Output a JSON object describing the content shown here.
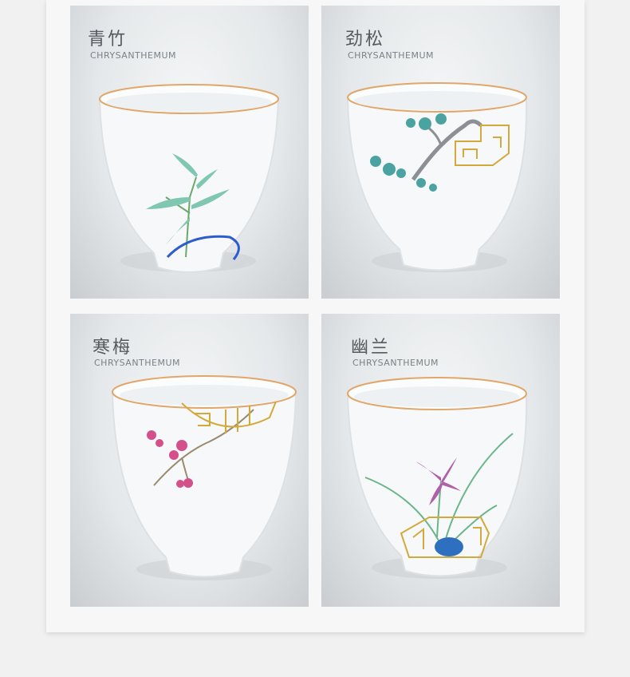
{
  "products": [
    {
      "name": "青竹",
      "subtitle": "CHRYSANTHEMUM",
      "motif": "bamboo"
    },
    {
      "name": "劲松",
      "subtitle": "CHRYSANTHEMUM",
      "motif": "pine"
    },
    {
      "name": "寒梅",
      "subtitle": "CHRYSANTHEMUM",
      "motif": "plum-blossom"
    },
    {
      "name": "幽兰",
      "subtitle": "CHRYSANTHEMUM",
      "motif": "orchid"
    }
  ],
  "colors": {
    "page_background": "#f1f1f1",
    "card_background": "#f7f7f7",
    "title_text": "#555a5e",
    "subtitle_text": "#7a8086",
    "rim_gold": "#e0a66a"
  }
}
